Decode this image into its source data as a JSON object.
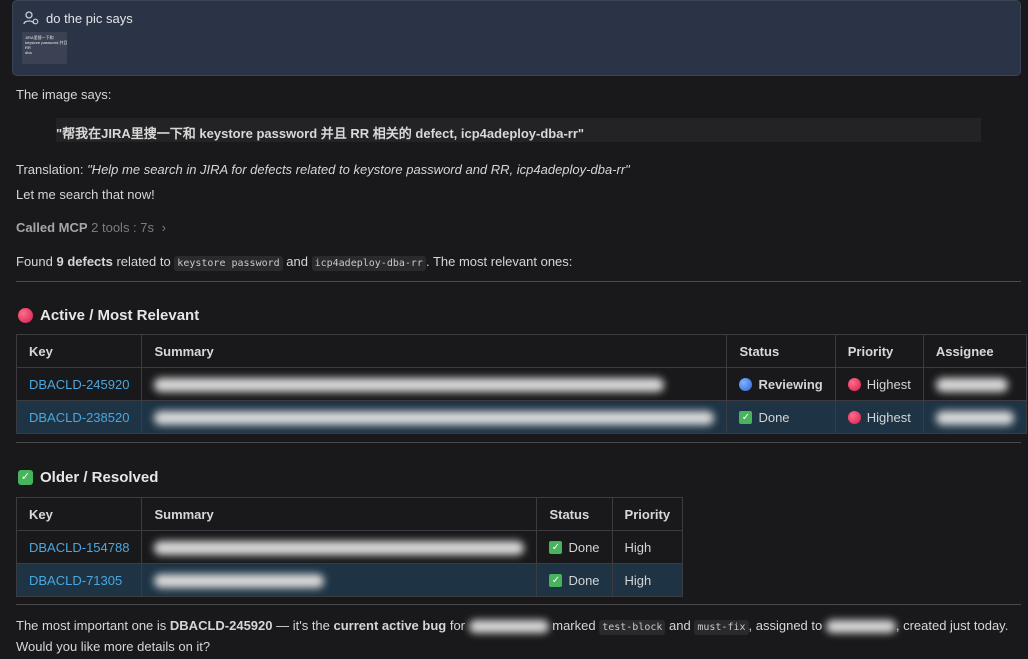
{
  "user_message": {
    "text": "do the pic says",
    "thumbnail_lines": [
      "JIRA里搜一下和",
      "keystore password 并且",
      "RR",
      "dba"
    ]
  },
  "intro": "The image says:",
  "quote": "\"帮我在JIRA里搜一下和 keystore password 并且 RR 相关的 defect, icp4adeploy-dba-rr\"",
  "translation_label": "Translation: ",
  "translation": "\"Help me search in JIRA for defects related to keystore password and RR, icp4adeploy-dba-rr\"",
  "search_line": "Let me search that now!",
  "mcp": {
    "label": "Called MCP",
    "detail": "2 tools : 7s",
    "chevron": "›"
  },
  "found": {
    "prefix": "Found ",
    "count": "9 defects",
    "middle": " related to ",
    "code1": "keystore password",
    "and": " and ",
    "code2": "icp4adeploy-dba-rr",
    "suffix": ". The most relevant ones:"
  },
  "section_active": {
    "title": "Active / Most Relevant",
    "icon": "red-circle-icon",
    "headers": [
      "Key",
      "Summary",
      "Status",
      "Priority",
      "Assignee"
    ],
    "rows": [
      {
        "key": "DBACLD-245920",
        "summary": "icp4adeploy-dba-rr pod will not be ready due to keystore password change",
        "status": "Reviewing",
        "priority": "Highest"
      },
      {
        "key": "DBACLD-238520",
        "summary": "",
        "status": "Done",
        "priority": "Highest"
      }
    ]
  },
  "section_resolved": {
    "title": "Older / Resolved",
    "icon": "check-mark-icon",
    "headers": [
      "Key",
      "Summary",
      "Status",
      "Priority"
    ],
    "rows": [
      {
        "key": "DBACLD-154788",
        "summary": "icp4adeploy-dba-rr pod is restarting continuously",
        "status": "Done",
        "priority": "High"
      },
      {
        "key": "DBACLD-71305",
        "summary": "deploy failed",
        "status": "Done",
        "priority": "High"
      }
    ]
  },
  "footer": {
    "p1": "The most important one is ",
    "key": "DBACLD-245920",
    "p2": " — it's the ",
    "bold2": "current active bug",
    "p3": " for ",
    "p4": " marked ",
    "code1": "test-block",
    "p5": " and ",
    "code2": "must-fix",
    "p6": ", assigned to ",
    "p7": ", created just today.",
    "line2": "Would you like more details on it?"
  },
  "colors": {
    "link": "#4aa7df",
    "alt_row": "#1e3445",
    "user_bg": "#2b3447"
  }
}
